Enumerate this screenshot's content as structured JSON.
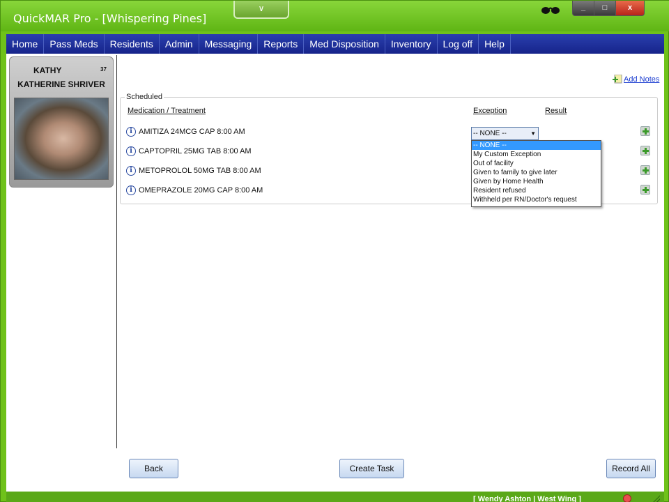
{
  "window": {
    "title": "QuickMAR Pro - [Whispering Pines]",
    "tab_glyph": "∨",
    "controls": {
      "minimize": "_",
      "maximize": "□",
      "close": "x"
    }
  },
  "menu": [
    "Home",
    "Pass Meds",
    "Residents",
    "Admin",
    "Messaging",
    "Reports",
    "Med Disposition",
    "Inventory",
    "Log off",
    "Help"
  ],
  "resident": {
    "first_name": "KATHY",
    "number": "37",
    "full_name": "KATHERINE SHRIVER"
  },
  "add_notes": {
    "label": "Add Notes"
  },
  "scheduled": {
    "legend": "Scheduled",
    "columns": {
      "medication": "Medication / Treatment",
      "exception": "Exception",
      "result": "Result"
    },
    "medications": [
      "AMITIZA 24MCG CAP 8:00 AM",
      "CAPTOPRIL 25MG TAB 8:00 AM",
      "METOPROLOL 50MG TAB 8:00 AM",
      "OMEPRAZOLE 20MG CAP 8:00 AM"
    ],
    "info_glyph": "i"
  },
  "exception": {
    "selected": "-- NONE --",
    "arrow": "▼",
    "options": [
      "-- NONE --",
      "My Custom Exception",
      "Out of facility",
      "Given to family to give later",
      "Given by Home Health",
      "Resident refused",
      "Withheld per RN/Doctor's request"
    ]
  },
  "buttons": {
    "back": "Back",
    "create_task": "Create Task",
    "record_all": "Record All"
  },
  "status": {
    "text": "[ Wendy Ashton | West Wing ]"
  }
}
